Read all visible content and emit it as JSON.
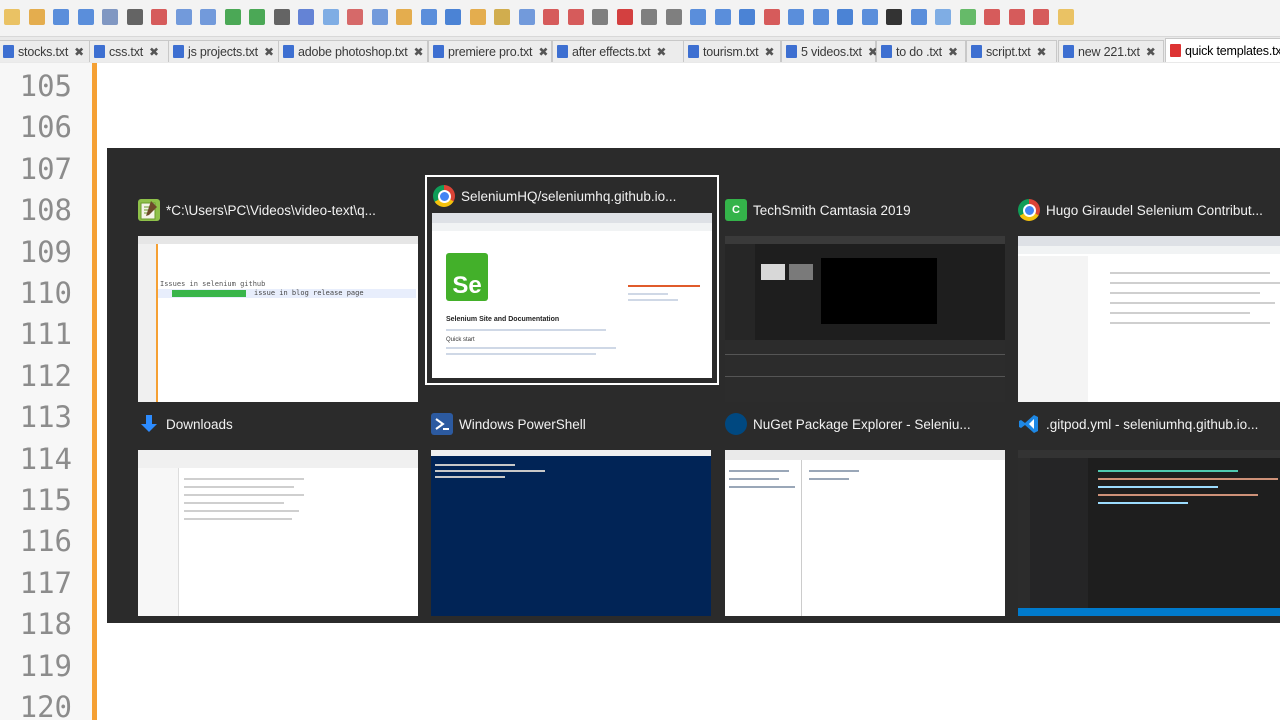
{
  "editor": {
    "line_numbers": [
      "105",
      "106",
      "107",
      "108",
      "109",
      "110",
      "111",
      "112",
      "113",
      "114",
      "115",
      "116",
      "117",
      "118",
      "119",
      "120"
    ]
  },
  "tabs": [
    {
      "label": "stocks.txt"
    },
    {
      "label": "css.txt"
    },
    {
      "label": "js projects.txt"
    },
    {
      "label": "adobe photoshop.txt"
    },
    {
      "label": "premiere pro.txt"
    },
    {
      "label": "after effects.txt"
    },
    {
      "label": "tourism.txt"
    },
    {
      "label": "5 videos.txt"
    },
    {
      "label": "to do .txt"
    },
    {
      "label": "script.txt"
    },
    {
      "label": "new 221.txt"
    },
    {
      "label": "quick templates.txt",
      "active": true
    }
  ],
  "task_switcher": {
    "windows": [
      {
        "title": "*C:\\Users\\PC\\Videos\\video-text\\q...",
        "icon": "notepad-plus-icon",
        "thumb_text": "Issues in selenium github",
        "thumb_sub": "issue in blog release page"
      },
      {
        "title": "SeleniumHQ/seleniumhq.github.io...",
        "icon": "chrome-icon",
        "selected": true,
        "thumb_heading": "Selenium Site and Documentation",
        "thumb_sub": "Quick start",
        "logo_text": "Se"
      },
      {
        "title": "TechSmith Camtasia 2019",
        "icon": "camtasia-icon"
      },
      {
        "title": "Hugo Giraudel Selenium Contribut...",
        "icon": "chrome-icon"
      },
      {
        "title": "Downloads",
        "icon": "download-arrow-icon"
      },
      {
        "title": "Windows PowerShell",
        "icon": "powershell-icon"
      },
      {
        "title": "NuGet Package Explorer - Seleniu...",
        "icon": "nuget-icon"
      },
      {
        "title": ".gitpod.yml - seleniumhq.github.io...",
        "icon": "vscode-icon"
      }
    ]
  },
  "colors": {
    "switcher_bg": "#2b2b2b",
    "fold_margin": "#f5a033",
    "active_tab_icon": "#dd3333"
  }
}
